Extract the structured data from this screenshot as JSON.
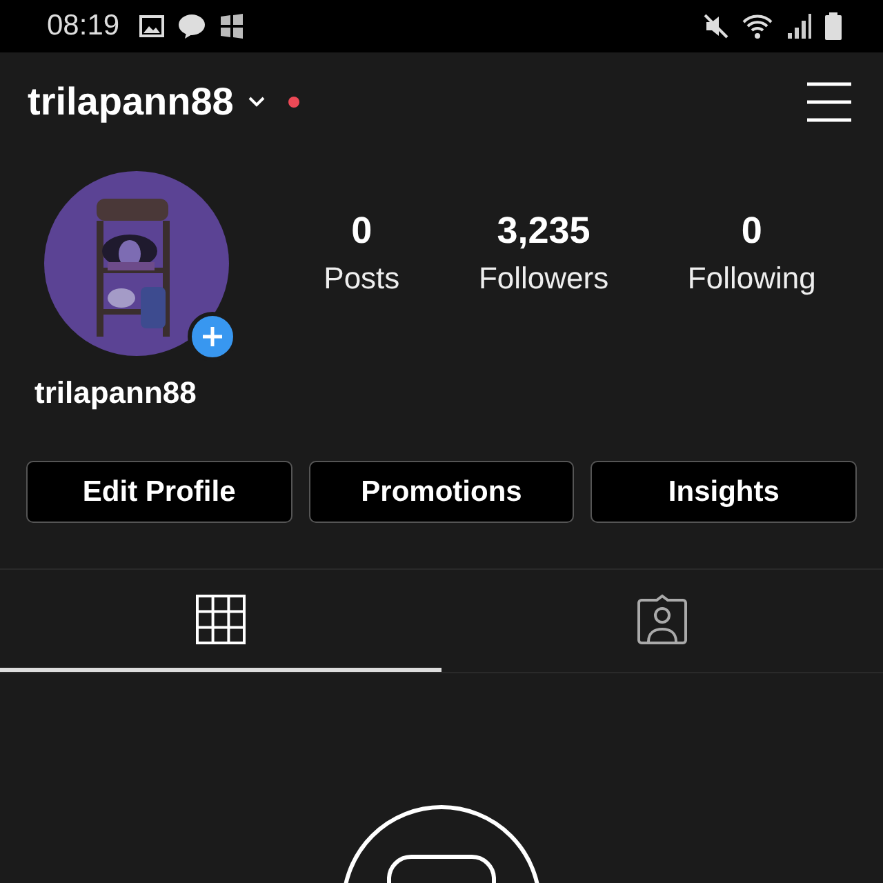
{
  "status_bar": {
    "time": "08:19"
  },
  "header": {
    "username": "trilapann88"
  },
  "profile": {
    "name": "trilapann88",
    "stats": [
      {
        "value": "0",
        "label": "Posts"
      },
      {
        "value": "3,235",
        "label": "Followers"
      },
      {
        "value": "0",
        "label": "Following"
      }
    ]
  },
  "buttons": [
    "Edit Profile",
    "Promotions",
    "Insights"
  ],
  "tabs": [
    {
      "kind": "grid",
      "selected": true
    },
    {
      "kind": "tagged",
      "selected": false
    }
  ]
}
